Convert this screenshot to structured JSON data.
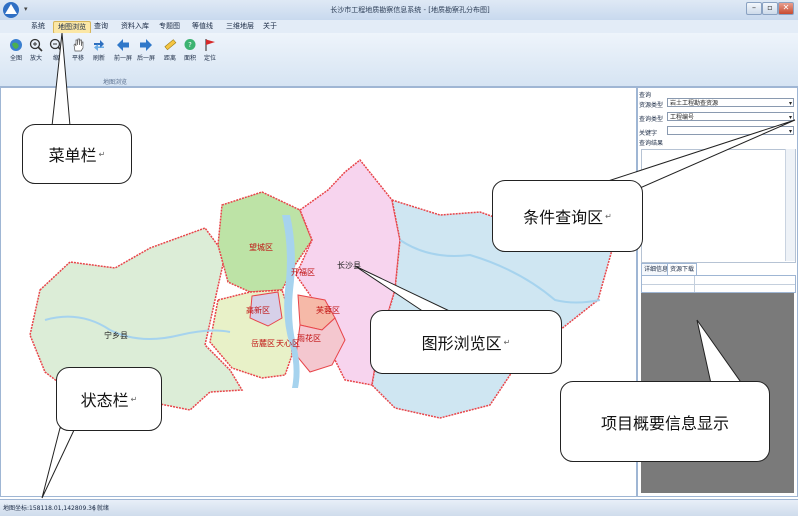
{
  "window": {
    "title": "长沙市工程地质勘察信息系统 - [地质勘察孔分布图]",
    "minimize_glyph": "–",
    "restore_glyph": "▫",
    "close_glyph": "✕"
  },
  "menu": [
    "系统",
    "地图浏览",
    "查询",
    "资料入库",
    "专题图",
    "等值线",
    "三维地层",
    "关于"
  ],
  "toolbar": {
    "tools": [
      {
        "label": "全图",
        "icon": "globe-icon"
      },
      {
        "label": "放大",
        "icon": "zoom-in-icon"
      },
      {
        "label": "缩",
        "icon": "zoom-out-icon"
      },
      {
        "label": "平移",
        "icon": "hand-pan-icon"
      },
      {
        "label": "刷新",
        "icon": "refresh-icon"
      },
      {
        "label": "前一屏",
        "icon": "arrow-left-icon"
      },
      {
        "label": "后一屏",
        "icon": "arrow-right-icon"
      },
      {
        "label": "距离",
        "icon": "ruler-icon"
      },
      {
        "label": "面积",
        "icon": "area-icon"
      },
      {
        "label": "定位",
        "icon": "flag-icon"
      }
    ],
    "group_label": "地图浏览"
  },
  "map": {
    "districts": {
      "wangcheng": "望城区",
      "kaifu": "开福区",
      "changsha": "长沙县",
      "yuelu": "岳麓区",
      "gaoxin": "高新区",
      "furong": "芙蓉区",
      "tianxin": "天心区",
      "yuhua": "雨花区",
      "ningxiang": "宁乡县"
    },
    "colors": {
      "ningxiang": "#dcedd7",
      "wangcheng": "#bde3a6",
      "changsha_west": "#f7d4ee",
      "changsha_east": "#cfe6f2",
      "yuelu": "#e8f1c8",
      "gaoxin": "#d6d0e8",
      "furong": "#f6b9a8",
      "yuhua": "#f4c7cf",
      "river": "#a6d3ee",
      "border": "#e8454a"
    }
  },
  "query": {
    "title": "查询",
    "resource_type_label": "资源类型",
    "resource_type_value": "岩土工程勘查资源",
    "query_type_label": "查询类型",
    "query_type_value": "工程编号",
    "keyword_label": "关键字",
    "keyword_value": "",
    "results_label": "查询结果"
  },
  "detail": {
    "tab_info": "详细信息",
    "tab_download": "资源下载"
  },
  "status": {
    "coords": "地图坐标:158118.01,142809.36",
    "state": "| 就绪"
  },
  "callouts": {
    "menu_bar": "菜单栏",
    "query_area": "条件查询区",
    "map_area": "图形浏览区",
    "status_bar": "状态栏",
    "project_info": "项目概要信息显示",
    "return_mark": "↵"
  }
}
